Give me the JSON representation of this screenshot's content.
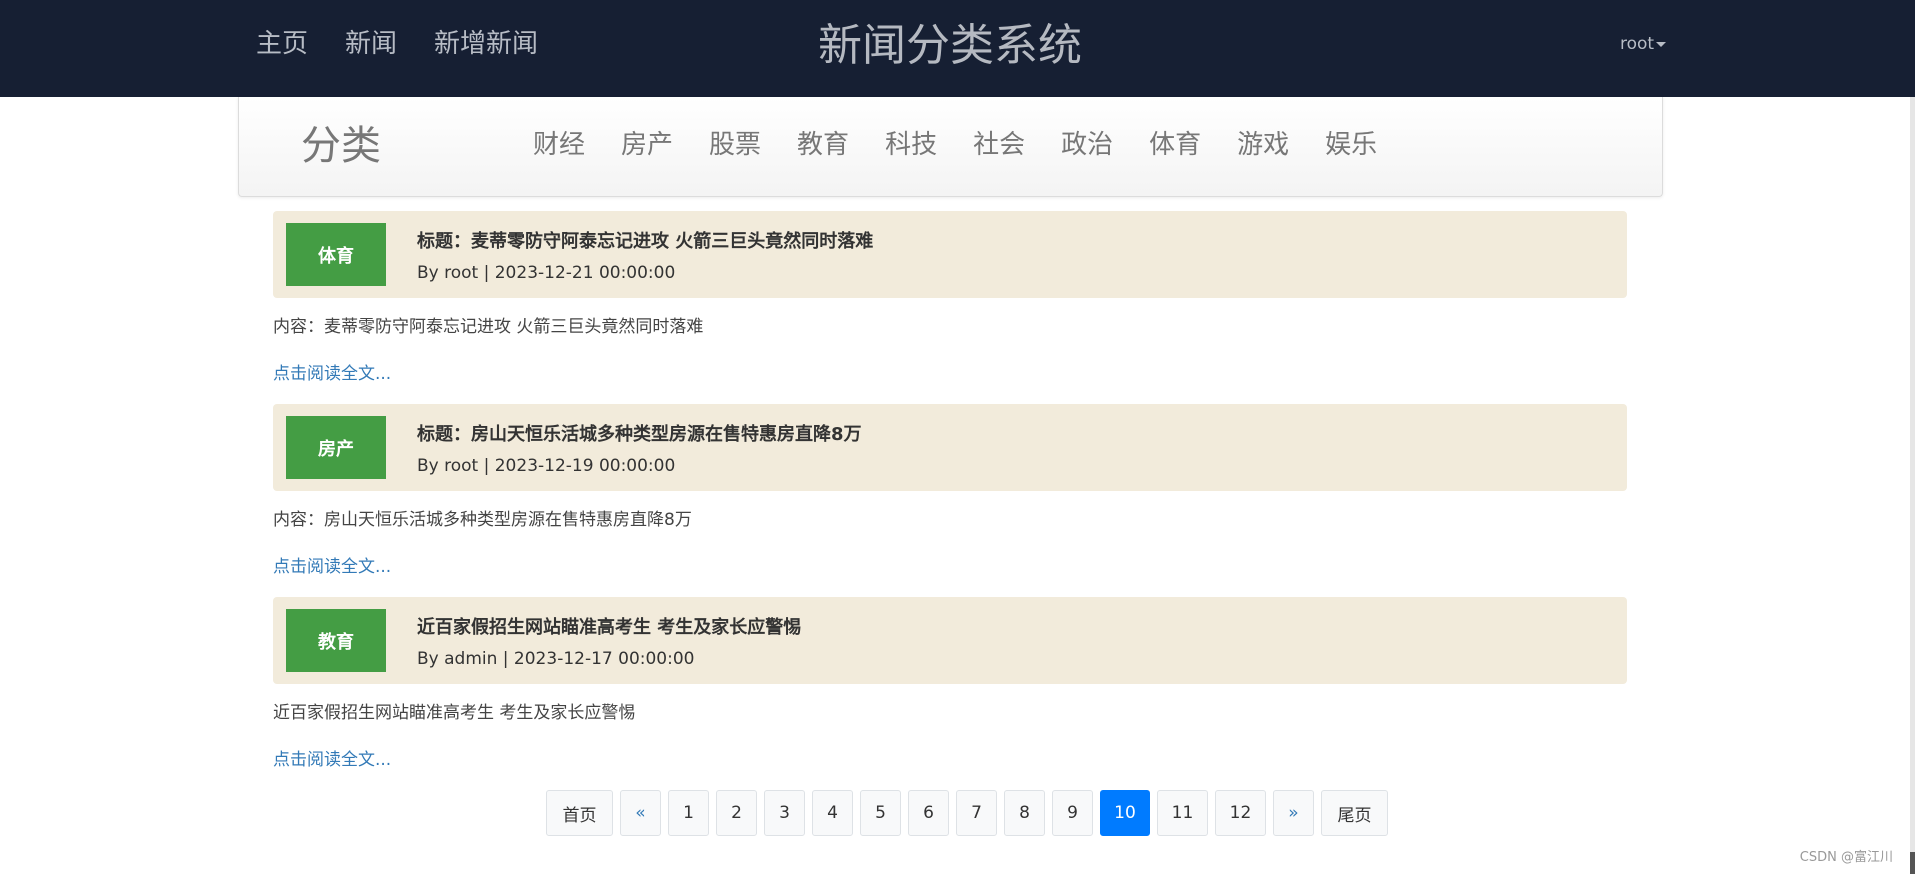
{
  "header": {
    "nav": [
      "主页",
      "新闻",
      "新增新闻"
    ],
    "title": "新闻分类系统",
    "user": "root"
  },
  "category_bar": {
    "brand": "分类",
    "categories": [
      "财经",
      "房产",
      "股票",
      "教育",
      "科技",
      "社会",
      "政治",
      "体育",
      "游戏",
      "娱乐"
    ]
  },
  "articles": [
    {
      "tag": "体育",
      "title": "标题：麦蒂零防守阿泰忘记进攻 火箭三巨头竟然同时落难",
      "meta": "By root | 2023-12-21 00:00:00",
      "content": "内容：麦蒂零防守阿泰忘记进攻 火箭三巨头竟然同时落难",
      "more": "点击阅读全文..."
    },
    {
      "tag": "房产",
      "title": "标题：房山天恒乐活城多种类型房源在售特惠房直降8万",
      "meta": "By root | 2023-12-19 00:00:00",
      "content": "内容：房山天恒乐活城多种类型房源在售特惠房直降8万",
      "more": "点击阅读全文..."
    },
    {
      "tag": "教育",
      "title": "近百家假招生网站瞄准高考生 考生及家长应警惕",
      "meta": "By admin | 2023-12-17 00:00:00",
      "content": "近百家假招生网站瞄准高考生 考生及家长应警惕",
      "more": "点击阅读全文..."
    }
  ],
  "pagination": {
    "first": "首页",
    "prev": "«",
    "pages": [
      "1",
      "2",
      "3",
      "4",
      "5",
      "6",
      "7",
      "8",
      "9",
      "10",
      "11",
      "12"
    ],
    "current": "10",
    "next": "»",
    "last": "尾页"
  },
  "watermark": "CSDN @富江川",
  "colors": {
    "topbar": "#161f33",
    "tag_bg": "#449d44",
    "article_head_bg": "#f2ebdb",
    "link": "#337ab7",
    "active_page": "#007bff"
  }
}
